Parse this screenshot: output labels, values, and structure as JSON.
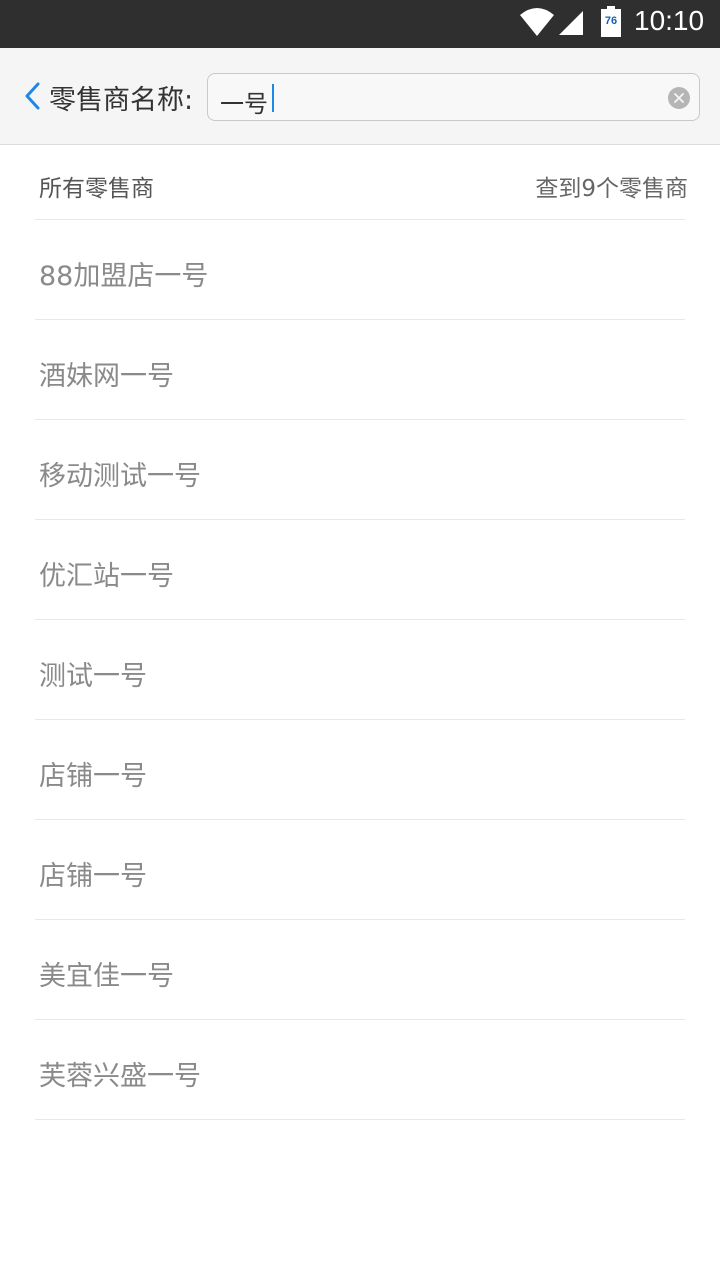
{
  "status_bar": {
    "time": "10:10",
    "battery_level": "76",
    "icons": [
      "wifi-icon",
      "cell-signal-icon",
      "battery-icon"
    ]
  },
  "header": {
    "label": "零售商名称:",
    "search": {
      "value": "一号"
    },
    "icons": [
      "chevron-left-icon",
      "clear-icon"
    ]
  },
  "list_header": {
    "title": "所有零售商",
    "count_text": "查到9个零售商"
  },
  "results": [
    {
      "name": "88加盟店一号"
    },
    {
      "name": "酒妹网一号"
    },
    {
      "name": "移动测试一号"
    },
    {
      "name": "优汇站一号"
    },
    {
      "name": "测试一号"
    },
    {
      "name": "店铺一号"
    },
    {
      "name": "店铺一号"
    },
    {
      "name": "美宜佳一号"
    },
    {
      "name": "芙蓉兴盛一号"
    }
  ],
  "colors": {
    "accent": "#1e88e5",
    "status_bar_bg": "#2f2f2f",
    "header_bg": "#f5f5f5"
  }
}
